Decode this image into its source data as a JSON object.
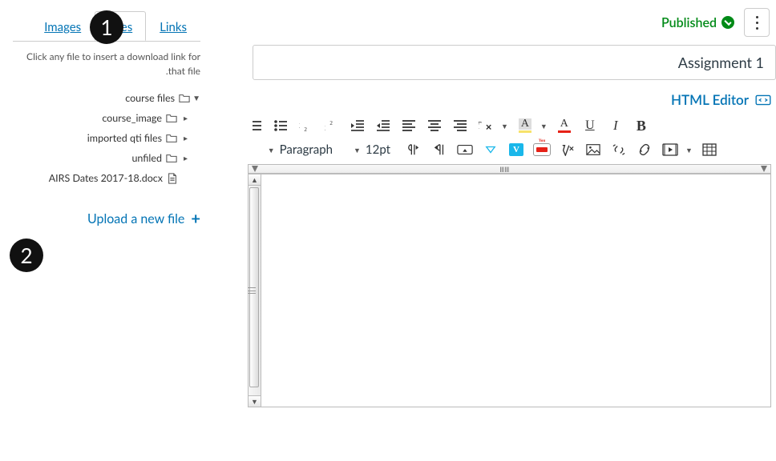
{
  "status": {
    "label": "Published"
  },
  "title": "Assignment 1",
  "html_editor_label": "HTML Editor",
  "toolbar": {
    "font_size": "12pt",
    "paragraph": "Paragraph"
  },
  "sidebar": {
    "tabs": {
      "links": "Links",
      "files": "Files",
      "images": "Images"
    },
    "helper": "Click any file to insert a download link for that file.",
    "tree": {
      "root": "course files",
      "folder1": "course_image",
      "folder2": "imported qti files",
      "folder3": "unfiled",
      "file1": "AIRS Dates 2017-18.docx"
    },
    "upload": "Upload a new file"
  },
  "badges": {
    "one": "1",
    "two": "2"
  }
}
